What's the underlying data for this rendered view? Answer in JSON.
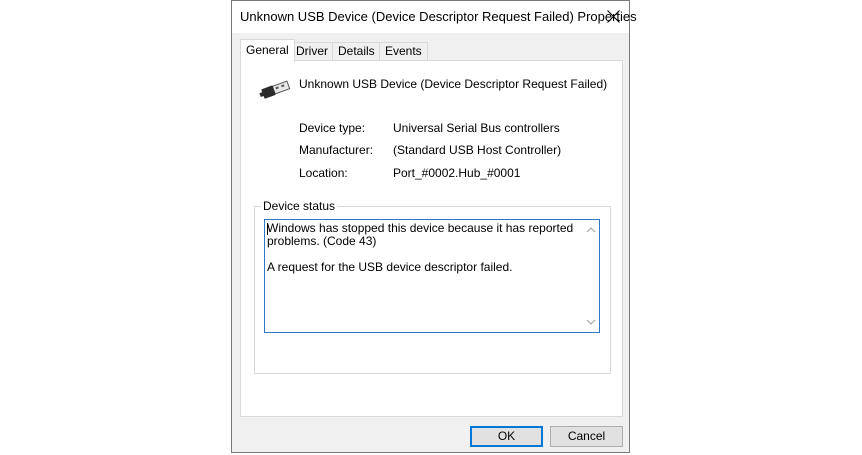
{
  "window": {
    "title": "Unknown USB Device (Device Descriptor Request Failed) Properties"
  },
  "tabs": [
    {
      "label": "General",
      "active": true
    },
    {
      "label": "Driver",
      "active": false
    },
    {
      "label": "Details",
      "active": false
    },
    {
      "label": "Events",
      "active": false
    }
  ],
  "device": {
    "icon": "usb-connector-icon",
    "name": "Unknown USB Device (Device Descriptor Request Failed)",
    "properties": [
      {
        "label": "Device type:",
        "value": "Universal Serial Bus controllers"
      },
      {
        "label": "Manufacturer:",
        "value": "(Standard USB Host Controller)"
      },
      {
        "label": "Location:",
        "value": "Port_#0002.Hub_#0001"
      }
    ]
  },
  "status": {
    "group_title": "Device status",
    "text": "Windows has stopped this device because it has reported\nproblems. (Code 43)\n\nA request for the USB device descriptor failed."
  },
  "buttons": {
    "ok": "OK",
    "cancel": "Cancel"
  },
  "colors": {
    "accent": "#0078d7",
    "focus_border": "#2a78c6"
  }
}
